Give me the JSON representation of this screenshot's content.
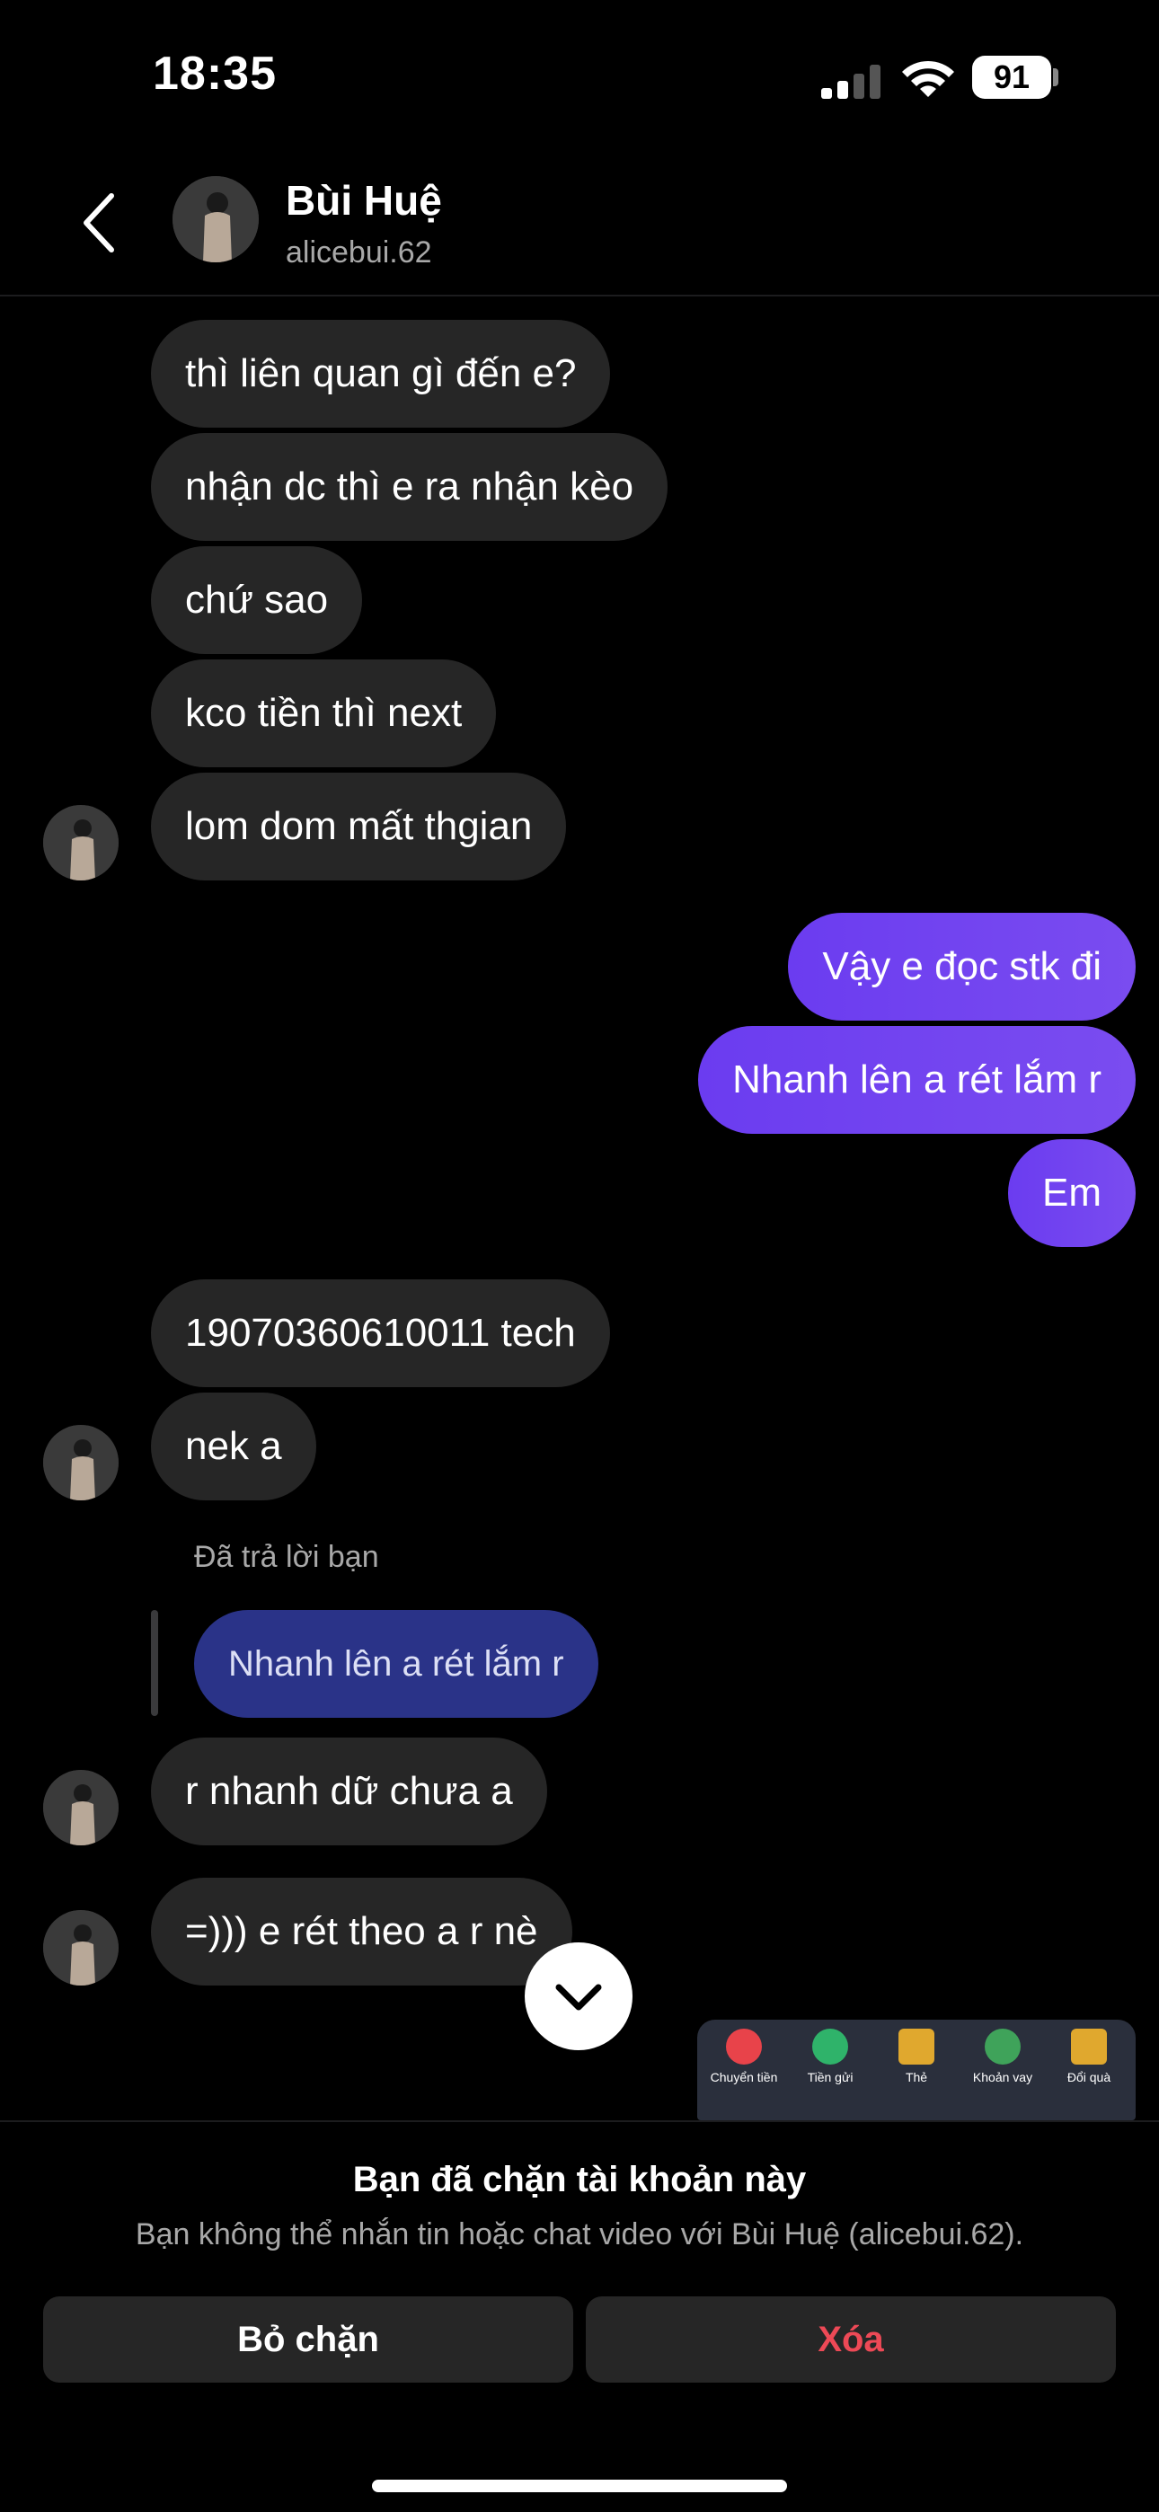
{
  "status_bar": {
    "time": "18:35",
    "battery": "91"
  },
  "header": {
    "name": "Bùi Huệ",
    "username": "alicebui.62"
  },
  "messages_group1": [
    "thì liên quan gì đến e?",
    "nhận dc thì e ra nhận kèo",
    "chứ sao",
    "kco tiền thì next",
    "lom dom mất thgian"
  ],
  "messages_out": [
    "Vậy e đọc stk đi",
    "Nhanh lên a rét lắm r",
    "Em"
  ],
  "messages_group2": [
    "19070360610011 tech",
    "nek a"
  ],
  "reply": {
    "label": "Đã trả lời bạn",
    "quoted": "Nhanh lên a rét lắm r"
  },
  "messages_group3": [
    "r nhanh dữ chưa a",
    "=))) e rét theo a r nè"
  ],
  "bank_widget": {
    "items": [
      "Chuyển tiền",
      "Tiền gửi",
      "Thẻ",
      "Khoản vay",
      "Đổi quà"
    ],
    "colors": [
      "#e8434a",
      "#2fb36a",
      "#e0a82e",
      "#3fa35a",
      "#e0a82e"
    ]
  },
  "footer": {
    "title": "Bạn đã chặn tài khoản này",
    "subtitle": "Bạn không thể nhắn tin hoặc chat video với Bùi Huệ (alicebui.62).",
    "unblock_label": "Bỏ chặn",
    "delete_label": "Xóa"
  },
  "colors": {
    "accent": "#7a4cf0",
    "delete": "#ed4956",
    "incoming": "#262626",
    "reply": "#2a3388"
  }
}
